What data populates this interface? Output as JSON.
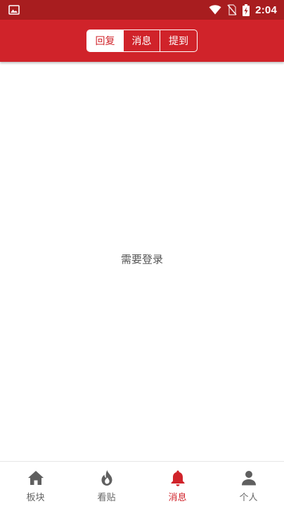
{
  "status_bar": {
    "time": "2:04",
    "icons": [
      "image-notification-icon",
      "wifi-icon",
      "no-sim-icon",
      "battery-charging-icon"
    ]
  },
  "header": {
    "tabs": [
      {
        "label": "回复",
        "active": true
      },
      {
        "label": "消息",
        "active": false
      },
      {
        "label": "提到",
        "active": false
      }
    ]
  },
  "main": {
    "message": "需要登录"
  },
  "bottom_nav": {
    "items": [
      {
        "label": "板块",
        "icon": "home-icon",
        "active": false
      },
      {
        "label": "看贴",
        "icon": "flame-icon",
        "active": false
      },
      {
        "label": "消息",
        "icon": "bell-icon",
        "active": true
      },
      {
        "label": "个人",
        "icon": "person-icon",
        "active": false
      }
    ]
  },
  "colors": {
    "status_bar": "#a81d1f",
    "header": "#d0232a",
    "accent": "#d0232a",
    "nav_inactive": "#666666"
  }
}
